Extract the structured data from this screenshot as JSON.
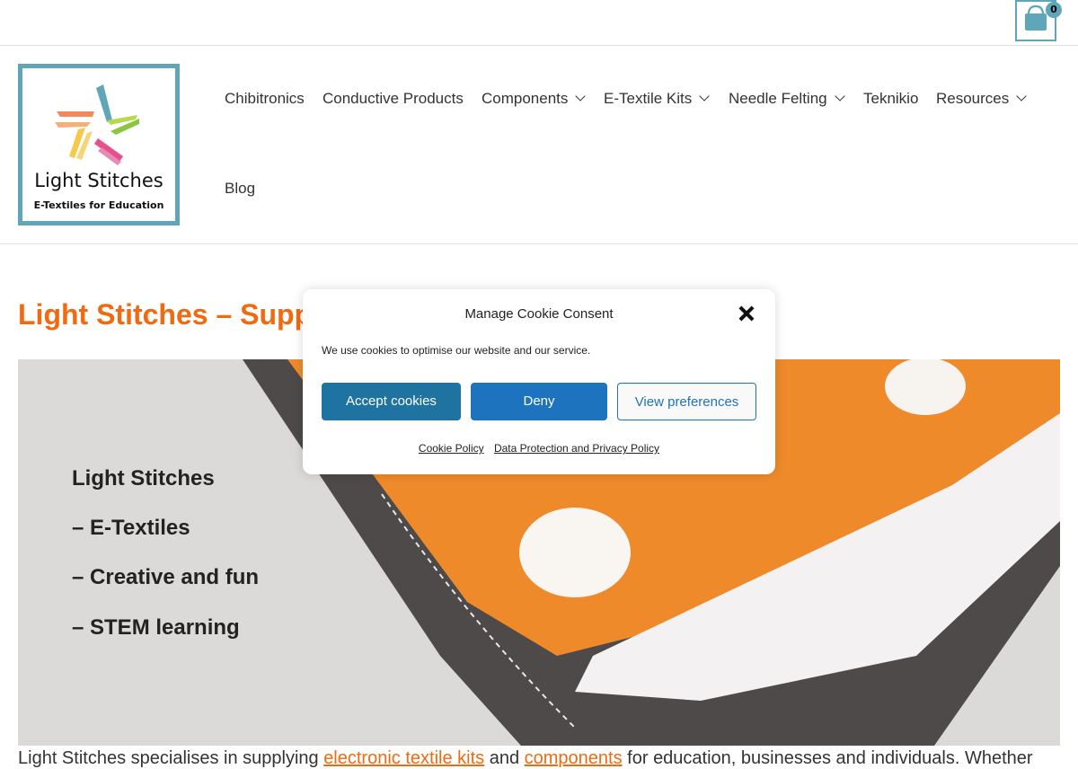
{
  "cart": {
    "count": "0",
    "icon": "shopping-bag-icon"
  },
  "logo": {
    "name": "Light Stitches",
    "tagline": "E-Textiles for Education"
  },
  "nav": {
    "items": [
      {
        "label": "Chibitronics"
      },
      {
        "label": "Conductive Products"
      },
      {
        "label": "Components"
      },
      {
        "label": "E-Textile Kits"
      },
      {
        "label": "Needle Felting"
      },
      {
        "label": "Teknikio"
      },
      {
        "label": "Resources"
      },
      {
        "label": "Blog"
      }
    ]
  },
  "page": {
    "title": "Light Stitches – Supp",
    "hero_lines": [
      "Light Stitches",
      "– E-Textiles",
      "– Creative and fun",
      "– STEM learning"
    ],
    "body": {
      "before": "Light Stitches specialises in supplying ",
      "link1": "electronic textile kits",
      "mid": " and ",
      "link2": "components",
      "after": " for education, businesses and individuals. Whether"
    }
  },
  "cookie": {
    "title": "Manage Cookie Consent",
    "message": "We use cookies to optimise our website and our service.",
    "accept": "Accept cookies",
    "deny": "Deny",
    "preferences": "View preferences",
    "links": [
      "Cookie Policy",
      "Data Protection and Privacy Policy"
    ]
  },
  "colors": {
    "accent": "#ef6a10",
    "brand": "#5fa7b8",
    "button": "#1e73be"
  }
}
